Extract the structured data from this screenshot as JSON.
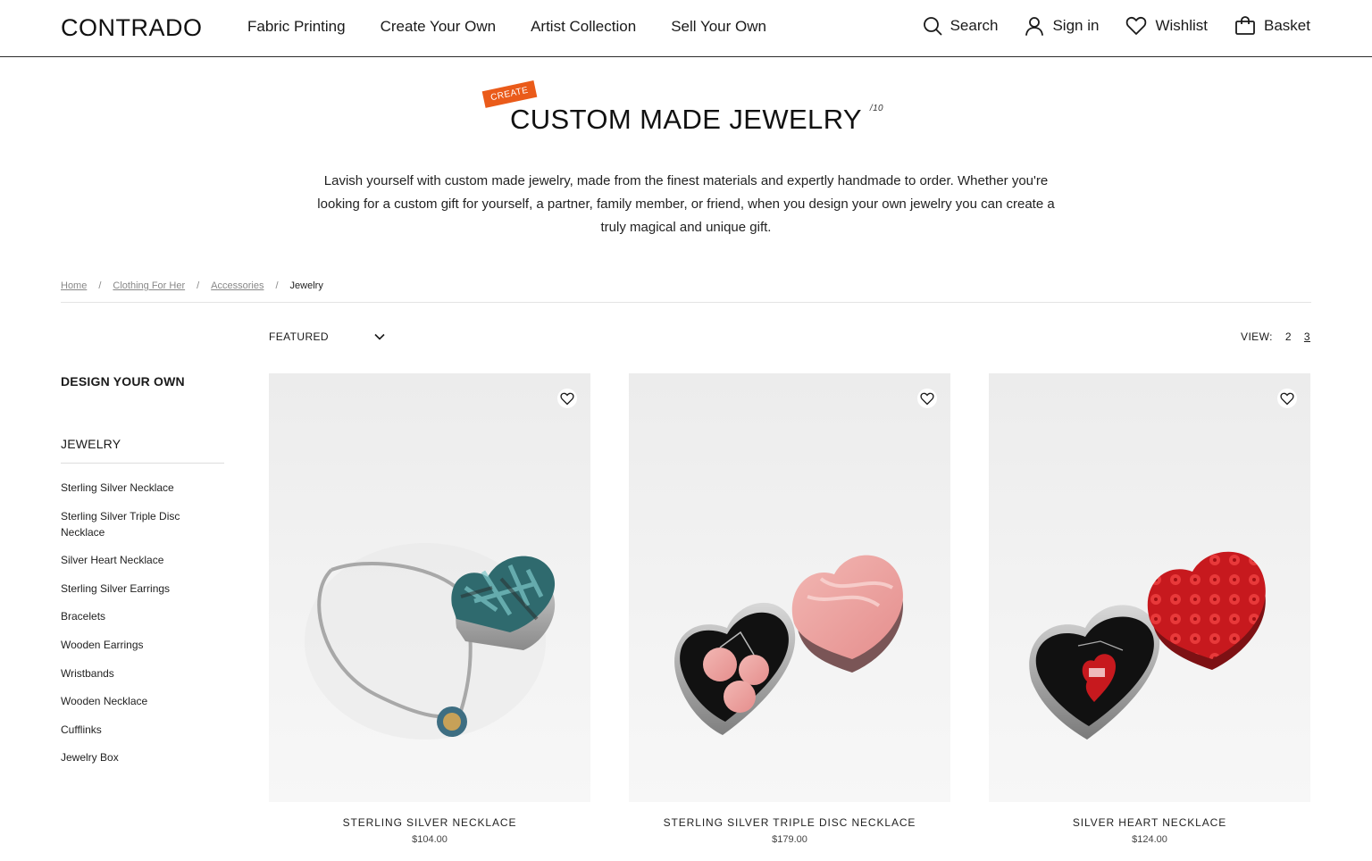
{
  "header": {
    "logo": "CONTRADO",
    "nav": [
      "Fabric Printing",
      "Create Your Own",
      "Artist Collection",
      "Sell Your Own"
    ],
    "search_label": "Search",
    "signin_label": "Sign in",
    "wishlist_label": "Wishlist",
    "basket_label": "Basket"
  },
  "hero": {
    "badge": "CREATE",
    "title": "CUSTOM MADE JEWELRY",
    "count": "/10",
    "intro": "Lavish yourself with custom made jewelry, made from the finest materials and expertly handmade to order. Whether you're looking for a custom gift for yourself, a partner, family member, or friend, when you design your own jewelry you can create a truly magical and unique gift."
  },
  "breadcrumb": {
    "items": [
      "Home",
      "Clothing For Her",
      "Accessories"
    ],
    "current": "Jewelry",
    "separator": "/"
  },
  "toolbar": {
    "sort_label": "FEATURED",
    "view_label": "VIEW:",
    "view_options": [
      "2",
      "3"
    ],
    "view_active": "3"
  },
  "sidebar": {
    "heading": "DESIGN YOUR OWN",
    "category": "JEWELRY",
    "items": [
      "Sterling Silver Necklace",
      "Sterling Silver Triple Disc Necklace",
      "Silver Heart Necklace",
      "Sterling Silver Earrings",
      "Bracelets",
      "Wooden Earrings",
      "Wristbands",
      "Wooden Necklace",
      "Cufflinks",
      "Jewelry Box"
    ]
  },
  "products": [
    {
      "name": "STERLING SILVER NECKLACE",
      "price": "$104.00"
    },
    {
      "name": "STERLING SILVER TRIPLE DISC NECKLACE",
      "price": "$179.00"
    },
    {
      "name": "SILVER HEART NECKLACE",
      "price": "$124.00"
    }
  ],
  "colors": {
    "accent": "#ea5b1a",
    "text": "#1a1a1a",
    "muted": "#888888"
  },
  "icons": [
    "search-icon",
    "user-icon",
    "heart-icon",
    "basket-icon",
    "chevron-down-icon"
  ]
}
